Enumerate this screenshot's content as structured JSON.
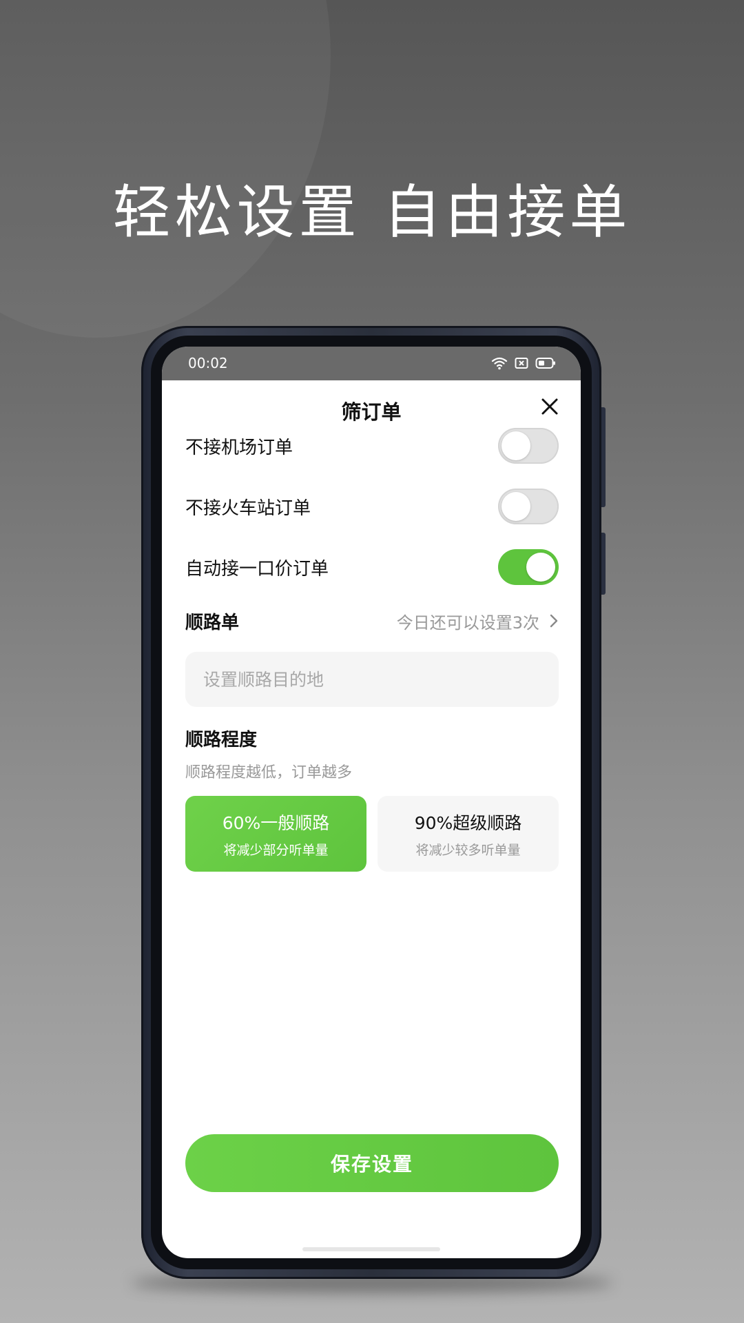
{
  "headline": "轻松设置 自由接单",
  "status_bar": {
    "time": "00:02",
    "icons": [
      "wifi-icon",
      "sim-icon",
      "battery-icon"
    ]
  },
  "dialog": {
    "title": "筛订单",
    "close_icon": "close-icon"
  },
  "toggles": [
    {
      "label": "不接机场订单",
      "on": false
    },
    {
      "label": "不接火车站订单",
      "on": false
    },
    {
      "label": "自动接一口价订单",
      "on": true
    }
  ],
  "route_order": {
    "label": "顺路单",
    "remaining_text": "今日还可以设置3次",
    "chevron_icon": "chevron-right-icon",
    "destination_placeholder": "设置顺路目的地"
  },
  "route_degree": {
    "label": "顺路程度",
    "note": "顺路程度越低，订单越多",
    "options": [
      {
        "title": "60%一般顺路",
        "subtitle": "将减少部分听单量",
        "selected": true
      },
      {
        "title": "90%超级顺路",
        "subtitle": "将减少较多听单量",
        "selected": false
      }
    ]
  },
  "save_button": "保存设置",
  "colors": {
    "accent": "#5ec43d",
    "toggle_off": "#e2e2e2",
    "muted_text": "#999999"
  }
}
